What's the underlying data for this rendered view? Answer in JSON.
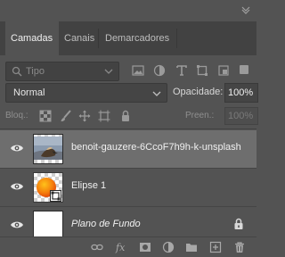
{
  "panel": {
    "tabs": [
      {
        "label": "Camadas",
        "active": true
      },
      {
        "label": "Canais",
        "active": false
      },
      {
        "label": "Demarcadores",
        "active": false
      }
    ]
  },
  "filter": {
    "kind_placeholder": "Tipo",
    "icons": [
      "image-filter-icon",
      "adjustment-filter-icon",
      "type-filter-icon",
      "shape-filter-icon",
      "smart-object-filter-icon"
    ]
  },
  "blend": {
    "mode": "Normal",
    "opacity_label": "Opacidade:",
    "opacity_value": "100%"
  },
  "locks": {
    "label": "Bloq.:",
    "fill_label": "Preen.:",
    "fill_value": "100%"
  },
  "layers": [
    {
      "name": "benoit-gauzere-6CcoF7h9h-k-unsplash",
      "selected": true,
      "visible": true
    },
    {
      "name": "Elipse 1",
      "selected": false,
      "visible": true
    },
    {
      "name": "Plano de Fundo",
      "selected": false,
      "visible": true,
      "locked": true
    }
  ],
  "colors": {
    "panel_bg": "#535353",
    "tabbar_bg": "#424242",
    "selected_row": "#6e6e6e",
    "ellipse_fill": "#f2700a"
  }
}
